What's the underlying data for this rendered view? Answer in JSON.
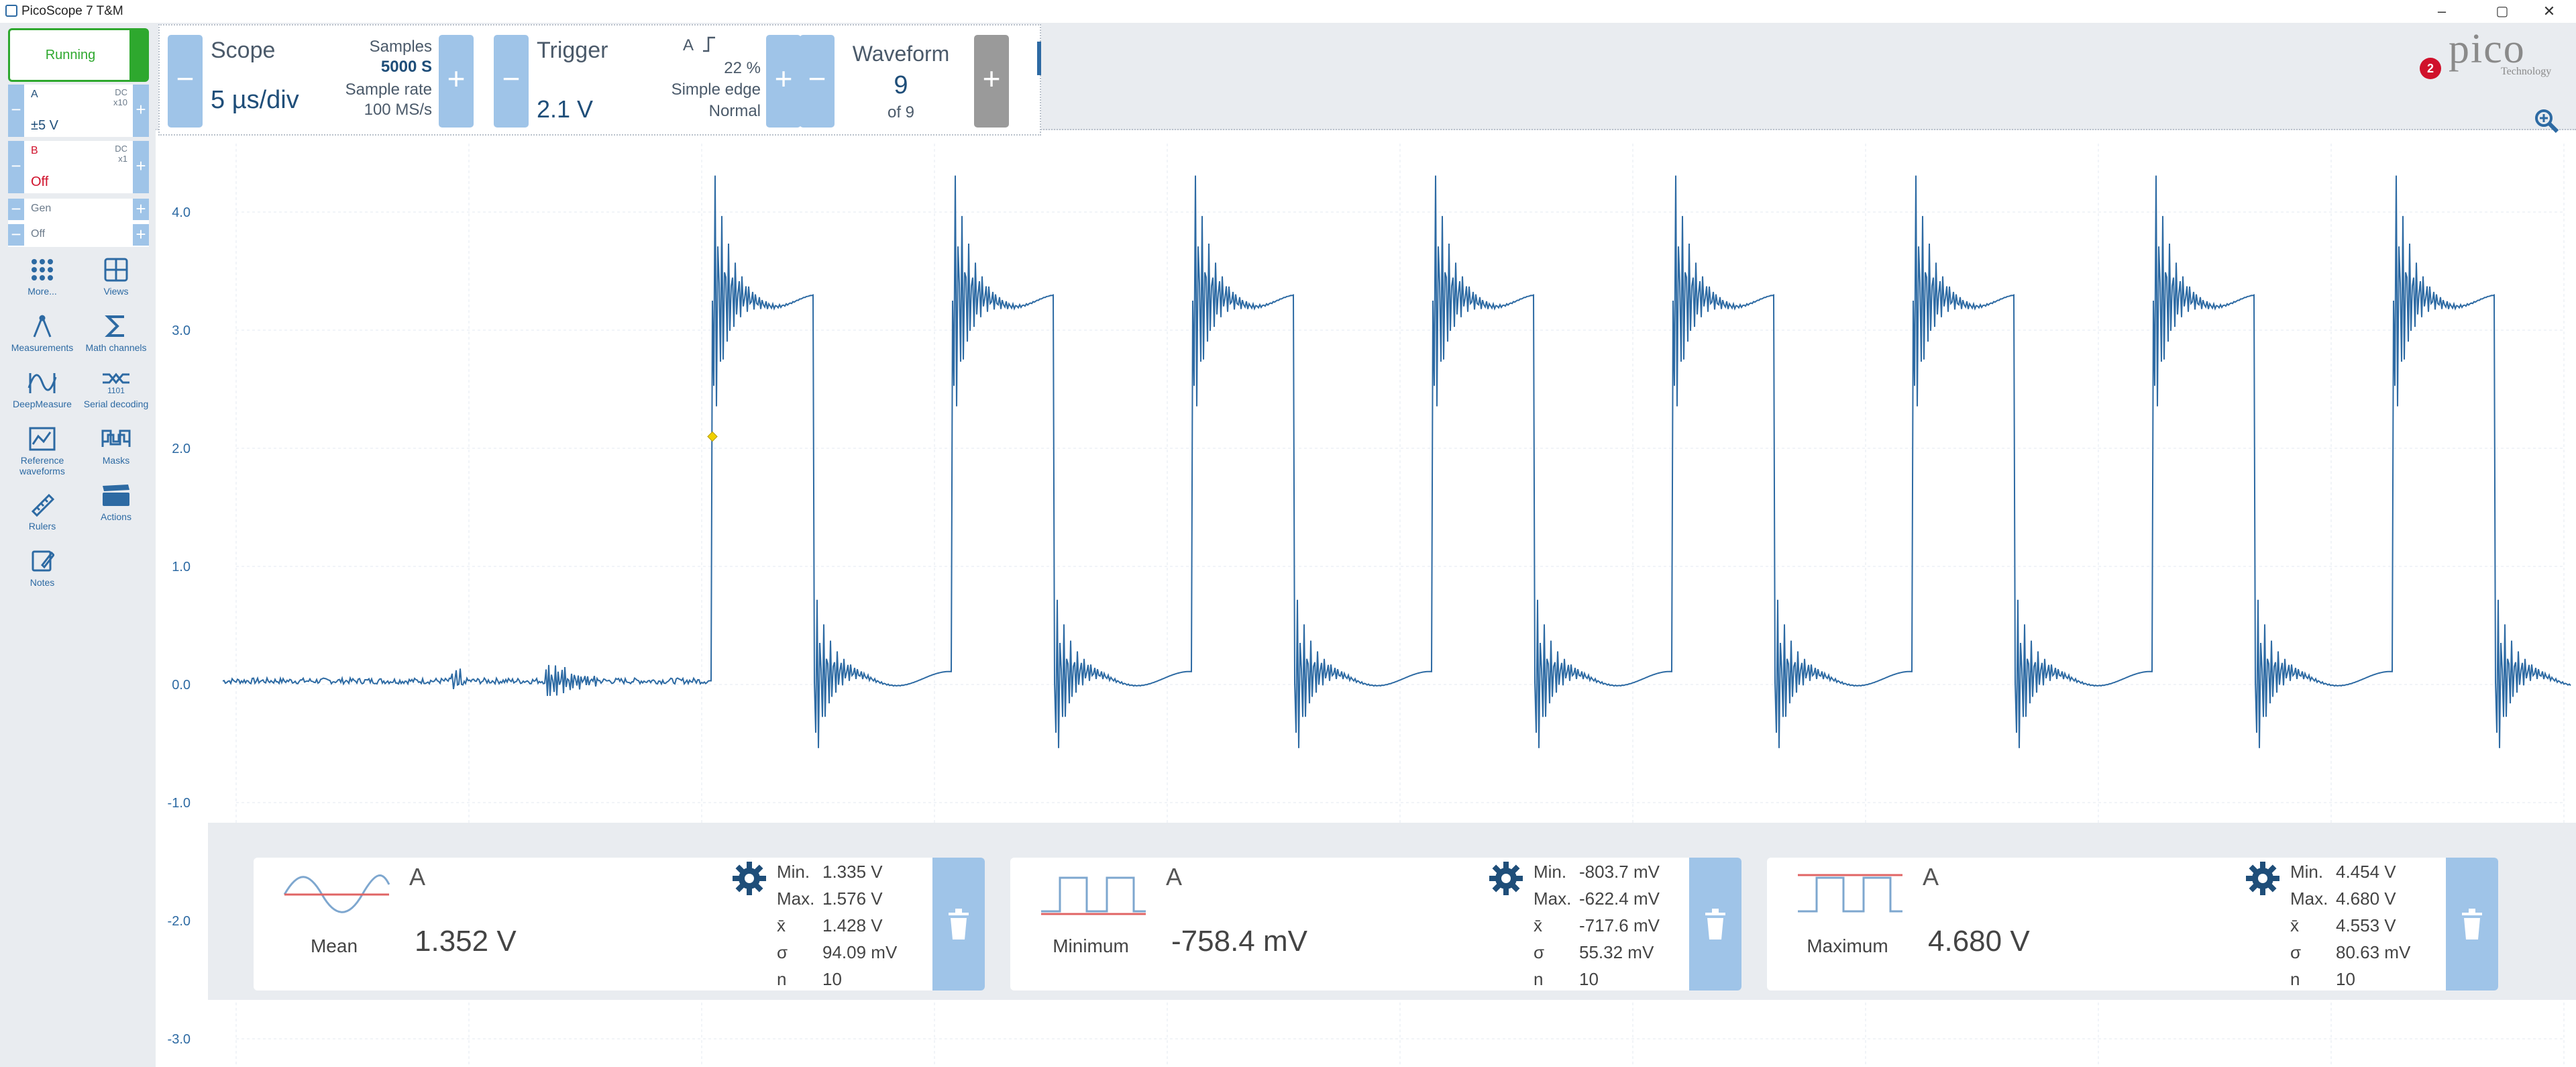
{
  "window": {
    "title": "PicoScope 7 T&M",
    "controls": [
      "–",
      "▢",
      "✕"
    ]
  },
  "run": {
    "label": "Running",
    "color": "#2ea82e"
  },
  "channels": [
    {
      "name": "A",
      "range": "±5 V",
      "coupling": "DC",
      "probe": "x10",
      "color": "#1f4e79"
    },
    {
      "name": "B",
      "range": "Off",
      "coupling": "DC",
      "probe": "x1",
      "color": "#d0112b"
    }
  ],
  "generator": {
    "label": "Gen",
    "state": "Off"
  },
  "tools": [
    {
      "label": "More...",
      "icon": "dots-grid-icon"
    },
    {
      "label": "Views",
      "icon": "views-grid-icon"
    },
    {
      "label": "Measurements",
      "icon": "caliper-icon"
    },
    {
      "label": "Math channels",
      "icon": "sigma-icon"
    },
    {
      "label": "DeepMeasure",
      "icon": "deepmeasure-icon"
    },
    {
      "label": "Serial decoding",
      "icon": "serial-decoding-icon"
    },
    {
      "label": "Reference waveforms",
      "icon": "reference-waveform-icon"
    },
    {
      "label": "Masks",
      "icon": "mask-icon"
    },
    {
      "label": "Rulers",
      "icon": "ruler-icon"
    },
    {
      "label": "Actions",
      "icon": "clapper-icon"
    },
    {
      "label": "Notes",
      "icon": "notes-icon"
    }
  ],
  "scope": {
    "label": "Scope",
    "timebase": "5 µs/div",
    "samples_label": "Samples",
    "samples": "5000 S",
    "sample_rate_label": "Sample rate",
    "sample_rate": "100 MS/s"
  },
  "trigger": {
    "label": "Trigger",
    "level": "2.1 V",
    "source": "A",
    "position": "22 %",
    "type": "Simple edge",
    "mode": "Normal"
  },
  "waveform": {
    "label": "Waveform",
    "index": "9",
    "count_text": "of 9"
  },
  "brand": {
    "name": "pico",
    "sub": "Technology",
    "notifications": "2"
  },
  "plot": {
    "y_ticks": [
      "4.0",
      "3.0",
      "2.0",
      "1.0",
      "0.0",
      "-1.0",
      "-2.0",
      "-3.0"
    ],
    "trace_color": "#2d6aa3",
    "trigger_marker_color": "#f0d000"
  },
  "measurements": [
    {
      "channel": "A",
      "type": "Mean",
      "value": "1.352 V",
      "stats": {
        "min_label": "Min.",
        "min": "1.335 V",
        "max_label": "Max.",
        "max": "1.576 V",
        "mean_label": "x̄",
        "mean": "1.428 V",
        "sd_label": "σ",
        "sd": "94.09 mV",
        "n_label": "n",
        "n": "10"
      }
    },
    {
      "channel": "A",
      "type": "Minimum",
      "value": "-758.4 mV",
      "stats": {
        "min_label": "Min.",
        "min": "-803.7 mV",
        "max_label": "Max.",
        "max": "-622.4 mV",
        "mean_label": "x̄",
        "mean": "-717.6 mV",
        "sd_label": "σ",
        "sd": "55.32 mV",
        "n_label": "n",
        "n": "10"
      }
    },
    {
      "channel": "A",
      "type": "Maximum",
      "value": "4.680 V",
      "stats": {
        "min_label": "Min.",
        "min": "4.454 V",
        "max_label": "Max.",
        "max": "4.680 V",
        "mean_label": "x̄",
        "mean": "4.553 V",
        "sd_label": "σ",
        "sd": "80.63 mV",
        "n_label": "n",
        "n": "10"
      }
    }
  ]
}
